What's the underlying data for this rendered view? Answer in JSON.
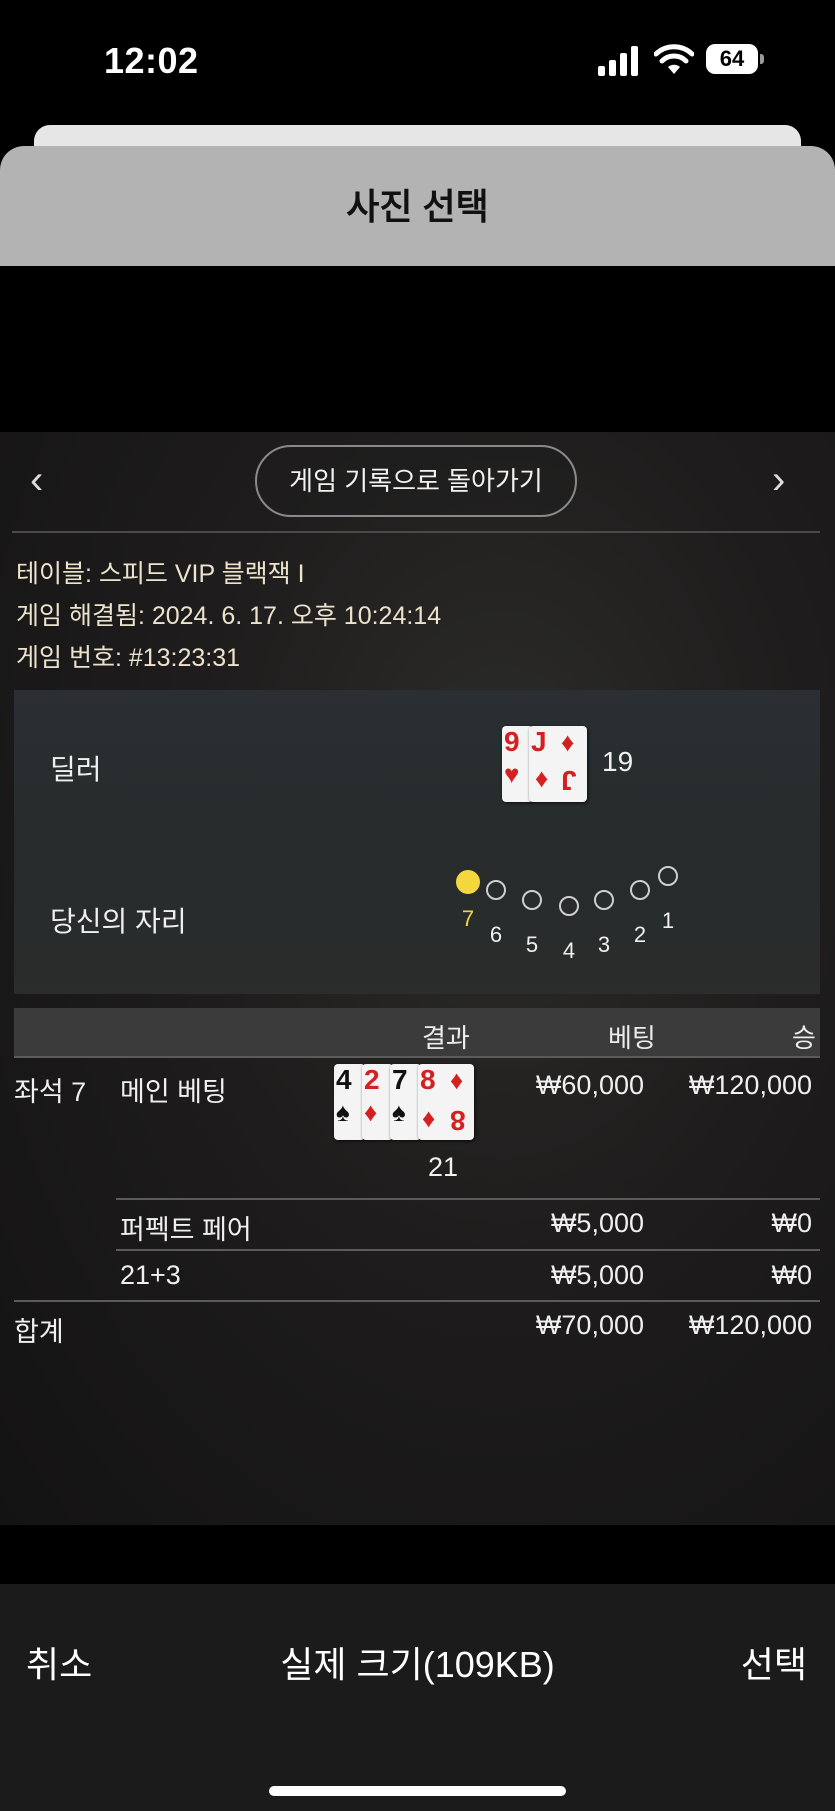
{
  "status_bar": {
    "time": "12:02",
    "battery": "64"
  },
  "sheet": {
    "title": "사진 선택"
  },
  "preview": {
    "nav": {
      "prev": "‹",
      "next": "›",
      "back_label": "게임 기록으로 돌아가기"
    },
    "info": {
      "table": "테이블: 스피드 VIP 블랙잭 I",
      "resolved": "게임 해결됨: 2024. 6. 17. 오후 10:24:14",
      "game_number": "게임 번호: #13:23:31"
    },
    "dealer": {
      "label": "딜러",
      "cards": [
        {
          "rank": "9",
          "suit": "♥"
        },
        {
          "rank": "J",
          "suit": "♦"
        }
      ],
      "total": "19"
    },
    "seats": {
      "label": "당신의 자리",
      "numbers": [
        "7",
        "6",
        "5",
        "4",
        "3",
        "2",
        "1"
      ],
      "active": "7"
    },
    "table": {
      "headers": {
        "result": "결과",
        "bet": "베팅",
        "win": "승"
      },
      "main": {
        "seat": "좌석 7",
        "name": "메인 베팅",
        "cards": [
          {
            "rank": "4",
            "suit": "♠"
          },
          {
            "rank": "2",
            "suit": "♦"
          },
          {
            "rank": "7",
            "suit": "♠"
          },
          {
            "rank": "8",
            "suit": "♦"
          }
        ],
        "total": "21",
        "bet": "₩60,000",
        "win": "₩120,000"
      },
      "side_bets": [
        {
          "name": "퍼펙트 페어",
          "bet": "₩5,000",
          "win": "₩0"
        },
        {
          "name": "21+3",
          "bet": "₩5,000",
          "win": "₩0"
        }
      ],
      "total": {
        "label": "합계",
        "bet": "₩70,000",
        "win": "₩120,000"
      }
    }
  },
  "toolbar": {
    "cancel": "취소",
    "size": "실제 크기(109KB)",
    "select": "선택"
  }
}
